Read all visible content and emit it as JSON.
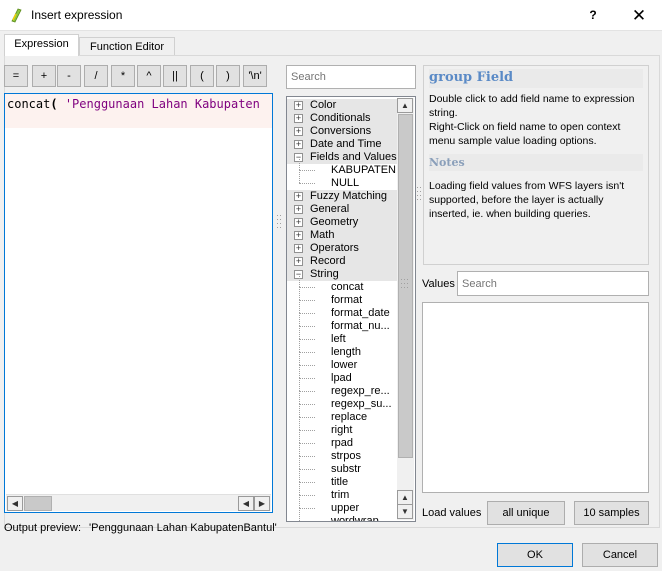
{
  "window": {
    "title": "Insert expression",
    "help_label": "?",
    "close_label": "✕"
  },
  "tabs": [
    {
      "label": "Expression",
      "active": true
    },
    {
      "label": "Function Editor",
      "active": false
    }
  ],
  "operators": [
    "=",
    "+",
    "-",
    "/",
    "*",
    "^",
    "||",
    "(",
    ")",
    "'\\n'"
  ],
  "editor": {
    "function_name": "concat",
    "paren": "(",
    "string_literal": " 'Penggunaan Lahan Kabupaten"
  },
  "output_preview": {
    "label": "Output preview:",
    "value": "'Penggunaan Lahan KabupatenBantul'"
  },
  "search": {
    "placeholder": "Search"
  },
  "tree": {
    "groups": [
      {
        "label": "Color",
        "expanded": false
      },
      {
        "label": "Conditionals",
        "expanded": false
      },
      {
        "label": "Conversions",
        "expanded": false
      },
      {
        "label": "Date and Time",
        "expanded": false
      },
      {
        "label": "Fields and Values",
        "expanded": true,
        "children": [
          "KABUPATEN",
          "NULL"
        ]
      },
      {
        "label": "Fuzzy Matching",
        "expanded": false
      },
      {
        "label": "General",
        "expanded": false
      },
      {
        "label": "Geometry",
        "expanded": false
      },
      {
        "label": "Math",
        "expanded": false
      },
      {
        "label": "Operators",
        "expanded": false
      },
      {
        "label": "Record",
        "expanded": false
      },
      {
        "label": "String",
        "expanded": true,
        "children": [
          "concat",
          "format",
          "format_date",
          "format_nu...",
          "left",
          "length",
          "lower",
          "lpad",
          "regexp_re...",
          "regexp_su...",
          "replace",
          "right",
          "rpad",
          "strpos",
          "substr",
          "title",
          "trim",
          "upper",
          "wordwrap"
        ]
      }
    ]
  },
  "help": {
    "title": "group Field",
    "text1": "Double click to add field name to expression string.",
    "text2": "Right-Click on field name to open context menu sample value loading options.",
    "notes_title": "Notes",
    "notes_text": "Loading field values from WFS layers isn't supported, before the layer is actually inserted, ie. when building queries."
  },
  "values": {
    "label": "Values",
    "search_placeholder": "Search",
    "load_label": "Load values",
    "all_unique": "all unique",
    "ten_samples": "10 samples"
  },
  "buttons": {
    "ok": "OK",
    "cancel": "Cancel"
  },
  "colors": {
    "accent": "#0078d7",
    "help_heading": "#5a8ac6",
    "string_literal": "#7f007f",
    "editor_line_bg": "#fdf2ef"
  },
  "icons": {
    "app": "qgis-expression-icon",
    "expander_collapsed": "plus-box-icon",
    "expander_expanded": "minus-box-icon"
  }
}
